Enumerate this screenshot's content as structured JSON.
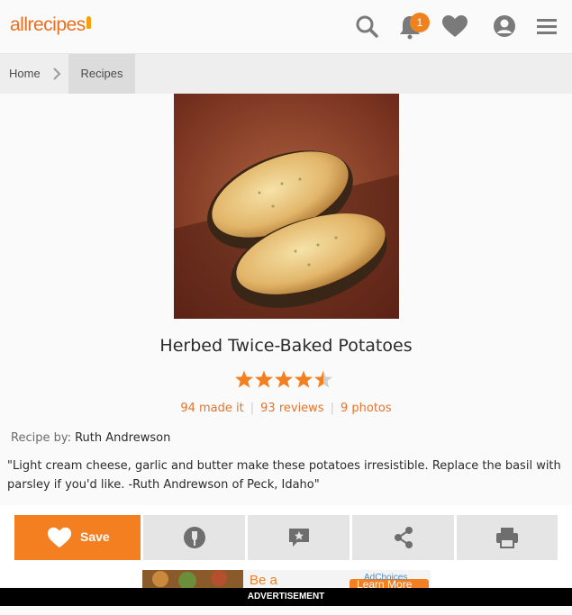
{
  "header": {
    "logo": "allrecipes",
    "notification_count": "1",
    "icons": [
      "search-icon",
      "bell-icon",
      "heart-icon",
      "profile-icon",
      "menu-icon"
    ],
    "brand_color": "#ec6e1f"
  },
  "breadcrumb": {
    "items": [
      "Home",
      "Recipes"
    ]
  },
  "recipe": {
    "title": "Herbed Twice-Baked Potatoes",
    "rating": 4.5,
    "rating_max": 5,
    "made_it": "94 made it",
    "reviews": "93 reviews",
    "photos": "9 photos",
    "by_label": "Recipe by:",
    "author": "Ruth Andrewson",
    "description": "\"Light cream cheese, garlic and butter make these potatoes irresistible. Replace the basil with parsley if you'd like. -Ruth Andrewson of Peck, Idaho\""
  },
  "actions": {
    "save_label": "Save",
    "buttons": [
      "heart-icon",
      "made-it-icon",
      "review-icon",
      "share-icon",
      "print-icon"
    ]
  },
  "ad": {
    "headline": "Be a",
    "choices": "AdChoices",
    "cta": "Learn More",
    "label": "ADVERTISEMENT"
  }
}
